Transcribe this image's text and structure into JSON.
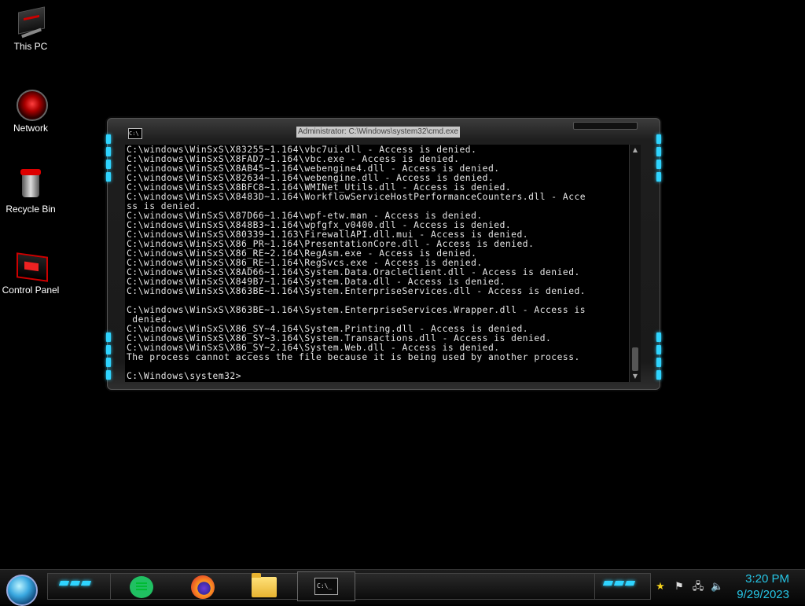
{
  "desktop": {
    "icons": [
      {
        "label": "This PC",
        "icon": "computer-icon"
      },
      {
        "label": "Network",
        "icon": "network-icon"
      },
      {
        "label": "Recycle Bin",
        "icon": "recycle-bin-icon"
      },
      {
        "label": "Control Panel",
        "icon": "control-panel-icon"
      }
    ]
  },
  "console": {
    "title": "Administrator: C:\\Windows\\system32\\cmd.exe",
    "icon": "cmd-icon",
    "output": "C:\\windows\\WinSxS\\X83255~1.164\\vbc7ui.dll - Access is denied.\nC:\\windows\\WinSxS\\X8FAD7~1.164\\vbc.exe - Access is denied.\nC:\\windows\\WinSxS\\X8AB45~1.164\\webengine4.dll - Access is denied.\nC:\\windows\\WinSxS\\X82634~1.164\\webengine.dll - Access is denied.\nC:\\windows\\WinSxS\\X8BFC8~1.164\\WMINet_Utils.dll - Access is denied.\nC:\\windows\\WinSxS\\X8483D~1.164\\WorkflowServiceHostPerformanceCounters.dll - Acce\nss is denied.\nC:\\windows\\WinSxS\\X87D66~1.164\\wpf-etw.man - Access is denied.\nC:\\windows\\WinSxS\\X848B3~1.164\\wpfgfx_v0400.dll - Access is denied.\nC:\\windows\\WinSxS\\X80339~1.163\\FirewallAPI.dll.mui - Access is denied.\nC:\\windows\\WinSxS\\X86_PR~1.164\\PresentationCore.dll - Access is denied.\nC:\\windows\\WinSxS\\X86_RE~2.164\\RegAsm.exe - Access is denied.\nC:\\windows\\WinSxS\\X86_RE~1.164\\RegSvcs.exe - Access is denied.\nC:\\windows\\WinSxS\\X8AD66~1.164\\System.Data.OracleClient.dll - Access is denied.\nC:\\windows\\WinSxS\\X849B7~1.164\\System.Data.dll - Access is denied.\nC:\\windows\\WinSxS\\X863BE~1.164\\System.EnterpriseServices.dll - Access is denied.\n\nC:\\windows\\WinSxS\\X863BE~1.164\\System.EnterpriseServices.Wrapper.dll - Access is\n denied.\nC:\\windows\\WinSxS\\X86_SY~4.164\\System.Printing.dll - Access is denied.\nC:\\windows\\WinSxS\\X86_SY~3.164\\System.Transactions.dll - Access is denied.\nC:\\windows\\WinSxS\\X86_SY~2.164\\System.Web.dll - Access is denied.\nThe process cannot access the file because it is being used by another process.\n\nC:\\Windows\\system32>"
  },
  "taskbar": {
    "start_icon": "start-orb-icon",
    "apps": [
      {
        "name": "notes-app-icon"
      },
      {
        "name": "firefox-icon"
      },
      {
        "name": "file-explorer-icon"
      },
      {
        "name": "command-prompt-icon",
        "glyph": "C:\\_",
        "active": true
      }
    ],
    "tray": {
      "icons": [
        "star-icon",
        "flag-icon",
        "network-tray-icon",
        "volume-icon"
      ],
      "time": "3:20 PM",
      "date": "9/29/2023"
    }
  },
  "colors": {
    "accent": "#2fd4ff",
    "clock_text": "#26c6e6",
    "console_text": "#e6e6e6",
    "console_bg": "#000000"
  }
}
